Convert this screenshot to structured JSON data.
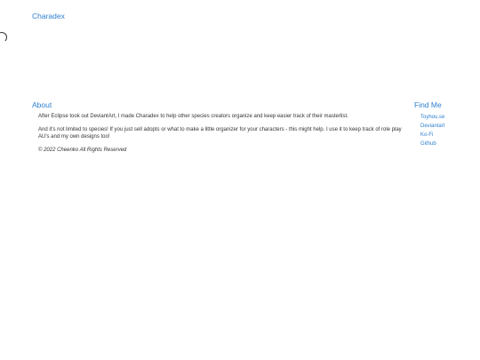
{
  "brand": {
    "label": "Charadex"
  },
  "about": {
    "heading": "About",
    "paragraph_1": "After Eclipse took out DeviantArt, I made Charadex to help other species creators organize and keep easier track of their masterlist.",
    "paragraph_2": "And it's not limited to species! If you just sell adopts or what to make a little organizer for your characters - this might help. I use it to keep track of role play AU's and my own designs too!",
    "copyright": "© 2022 Cheenko All Rights Reserved"
  },
  "find_me": {
    "heading": "Find Me",
    "links": [
      {
        "label": "Toyhou.se"
      },
      {
        "label": "Deviantart"
      },
      {
        "label": "Ko-Fi"
      },
      {
        "label": "Github"
      }
    ]
  },
  "colors": {
    "accent": "#2f80d1",
    "text": "#333333"
  }
}
